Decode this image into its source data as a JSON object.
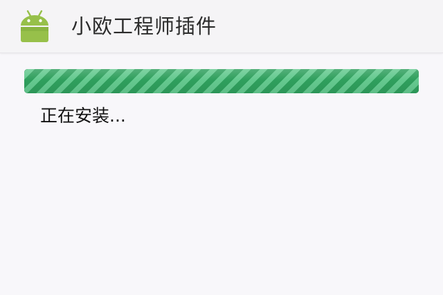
{
  "app": {
    "title": "小欧工程师插件",
    "icon": "android-robot-icon",
    "icon_color": "#97c04a"
  },
  "install": {
    "progress": 1.0,
    "status_text": "正在安装...",
    "bar_color": "#2f9f5d",
    "stripe_color": "#64c98f"
  }
}
